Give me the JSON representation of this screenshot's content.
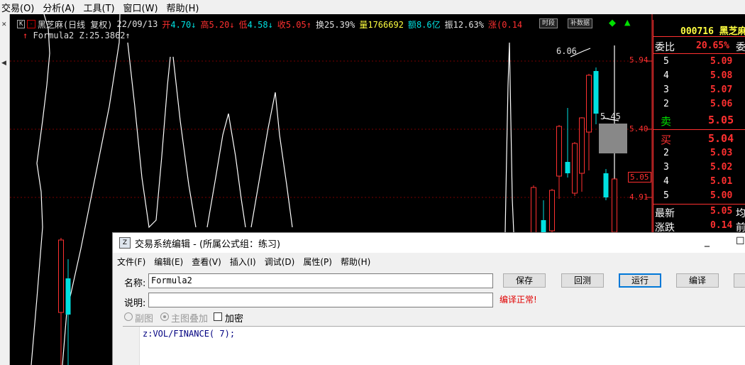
{
  "menubar": [
    {
      "label": "交易(O)"
    },
    {
      "label": "分析(A)"
    },
    {
      "label": "工具(T)"
    },
    {
      "label": "窗口(W)"
    },
    {
      "label": "帮助(H)"
    }
  ],
  "infobar": {
    "k_badge": "K",
    "x_badge": "-",
    "title": "黑芝麻(日线 复权)",
    "date": "22/09/13",
    "open_label": "开",
    "open_value": "4.70",
    "high_label": "高",
    "high_value": "5.20",
    "low_label": "低",
    "low_value": "4.58",
    "close_label": "收",
    "close_value": "5.05",
    "turnover_label": "换",
    "turnover_value": "25.39%",
    "volume_label": "量",
    "volume_value": "1766692",
    "amount_label": "额",
    "amount_value": "8.6亿",
    "amplitude_label": "振",
    "amplitude_value": "12.63%",
    "change_label": "涨",
    "change_value": "(0.14",
    "btn_timeline": "时段",
    "btn_fill": "补数据"
  },
  "formula_bar": {
    "name": "Formula2",
    "z_label": "Z:",
    "z_value": "25.3862"
  },
  "price_scale": [
    "5.94",
    "5.40",
    "5.05",
    "4.91"
  ],
  "chart_annotations": {
    "high_mark": "6.06",
    "mid_mark": "5.45"
  },
  "quote_panel": {
    "code": "000716",
    "name": "黑芝麻",
    "ratio_label": "委比",
    "ratio_value": "20.65%",
    "ratio_tail": "委",
    "sell": [
      {
        "level": "5",
        "price": "5.09"
      },
      {
        "level": "4",
        "price": "5.08"
      },
      {
        "level": "3",
        "price": "5.07"
      },
      {
        "level": "2",
        "price": "5.06"
      },
      {
        "level": "卖",
        "price": "5.05"
      }
    ],
    "buy": [
      {
        "level": "买",
        "price": "5.04"
      },
      {
        "level": "2",
        "price": "5.03"
      },
      {
        "level": "3",
        "price": "5.02"
      },
      {
        "level": "4",
        "price": "5.01"
      },
      {
        "level": "5",
        "price": "5.00"
      }
    ],
    "latest_label": "最新",
    "latest_value": "5.05",
    "latest_tail": "均",
    "change_label": "涨跌",
    "change_value": "0.14",
    "change_tail": "前"
  },
  "dialog": {
    "title": "交易系统编辑 - (所属公式组：练习)",
    "min_glyph": "_",
    "max_glyph": "☐",
    "menu": [
      {
        "label": "文件(F)"
      },
      {
        "label": "编辑(E)"
      },
      {
        "label": "查看(V)"
      },
      {
        "label": "插入(I)"
      },
      {
        "label": "调试(D)"
      },
      {
        "label": "属性(P)"
      },
      {
        "label": "帮助(H)"
      }
    ],
    "name_label": "名称:",
    "name_value": "Formula2",
    "desc_label": "说明:",
    "desc_value": "",
    "compile_msg": "编译正常!",
    "buttons": {
      "save": "保存",
      "test": "回测",
      "run": "运行",
      "compile": "编译"
    },
    "radio_sub": "副图",
    "radio_main": "主图叠加",
    "check_encrypt": "加密",
    "code": "z:VOL/FINANCE( 7);"
  },
  "colors": {
    "up": "#ff3030",
    "down": "#00e0e0",
    "line": "#ffffff"
  }
}
